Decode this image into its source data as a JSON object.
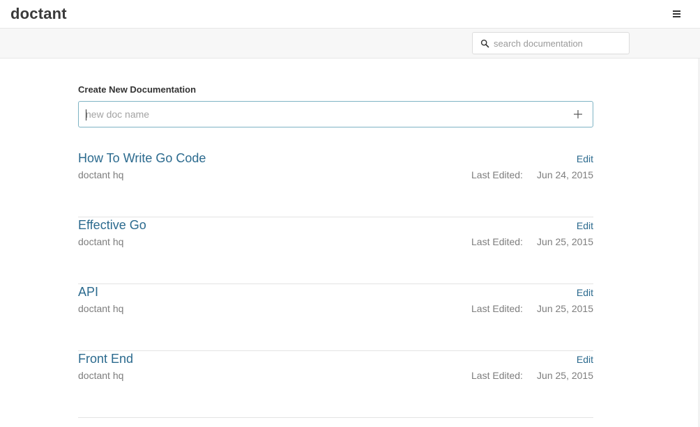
{
  "app": {
    "brand": "doctant"
  },
  "search": {
    "placeholder": "search documentation"
  },
  "create": {
    "label": "Create New Documentation",
    "placeholder": "new doc name"
  },
  "docs": [
    {
      "title": "How To Write Go Code",
      "owner": "doctant hq",
      "edit_label": "Edit",
      "last_edited_label": "Last Edited:",
      "date": "Jun 24, 2015"
    },
    {
      "title": "Effective Go",
      "owner": "doctant hq",
      "edit_label": "Edit",
      "last_edited_label": "Last Edited:",
      "date": "Jun 25, 2015"
    },
    {
      "title": "API",
      "owner": "doctant hq",
      "edit_label": "Edit",
      "last_edited_label": "Last Edited:",
      "date": "Jun 25, 2015"
    },
    {
      "title": "Front End",
      "owner": "doctant hq",
      "edit_label": "Edit",
      "last_edited_label": "Last Edited:",
      "date": "Jun 25, 2015"
    }
  ],
  "icons": {
    "menu": "hamburger-icon",
    "search": "search-icon",
    "add": "plus-icon"
  },
  "colors": {
    "link": "#2b6a8e",
    "focus_border": "#7eb3c4"
  }
}
